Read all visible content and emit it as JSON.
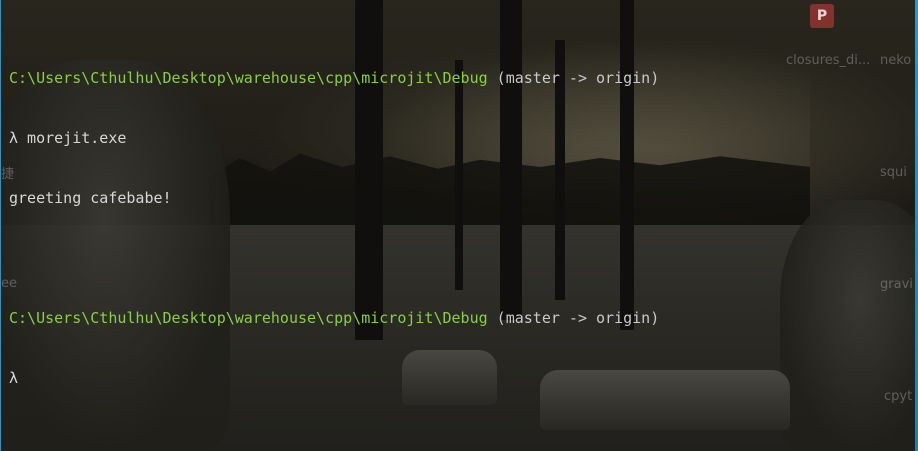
{
  "terminal": {
    "lines": [
      {
        "path": "C:\\Users\\Cthulhu\\Desktop\\warehouse\\cpp\\microjit\\Debug",
        "branch": " (master -> origin)"
      },
      {
        "prompt": "λ",
        "command": " morejit.exe"
      },
      {
        "output": "greeting cafebabe!"
      },
      {
        "output": ""
      },
      {
        "path": "C:\\Users\\Cthulhu\\Desktop\\warehouse\\cpp\\microjit\\Debug",
        "branch": " (master -> origin)"
      },
      {
        "prompt": "λ",
        "command": ""
      }
    ]
  },
  "desktop": {
    "icons": [
      {
        "label": "closures_di...",
        "icon": "pdf-icon"
      },
      {
        "label": "neko"
      },
      {
        "label": "squi"
      },
      {
        "label": "gravi"
      },
      {
        "label": "cpyt"
      },
      {
        "label": "捷"
      },
      {
        "label": "ee"
      }
    ]
  },
  "colors": {
    "path_green": "#8ad03a",
    "text": "#d7d7d7",
    "accent_blue": "#16a0d2"
  }
}
